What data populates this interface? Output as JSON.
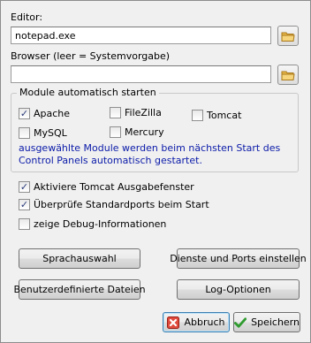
{
  "editor": {
    "label": "Editor:",
    "value": "notepad.exe"
  },
  "browser": {
    "label": "Browser (leer = Systemvorgabe)",
    "value": ""
  },
  "autostart": {
    "title": "Module automatisch starten",
    "modules": [
      {
        "label": "Apache",
        "checked": true
      },
      {
        "label": "FileZilla",
        "checked": false
      },
      {
        "label": "Tomcat",
        "checked": false
      },
      {
        "label": "MySQL",
        "checked": false
      },
      {
        "label": "Mercury",
        "checked": false
      }
    ],
    "info": "ausgewählte Module werden beim nächsten Start des Control Panels automatisch gestartet."
  },
  "options": [
    {
      "label": "Aktiviere Tomcat Ausgabefenster",
      "checked": true
    },
    {
      "label": "Überprüfe Standardports beim Start",
      "checked": true
    },
    {
      "label": "zeige Debug-Informationen",
      "checked": false
    }
  ],
  "buttons": {
    "language": "Sprachauswahl",
    "services_ports": "Dienste und Ports einstellen",
    "custom_files": "Benutzerdefinierte Dateien",
    "log_options": "Log-Optionen",
    "cancel": "Abbruch",
    "save": "Speichern"
  },
  "colors": {
    "info_text": "#0a1aa8",
    "cancel_icon": "#d9302a",
    "save_icon": "#2f9b2f",
    "folder_icon": "#e8b84a"
  },
  "icons": {
    "folder": "folder-icon",
    "cancel": "red-x-icon",
    "save": "green-check-icon"
  }
}
